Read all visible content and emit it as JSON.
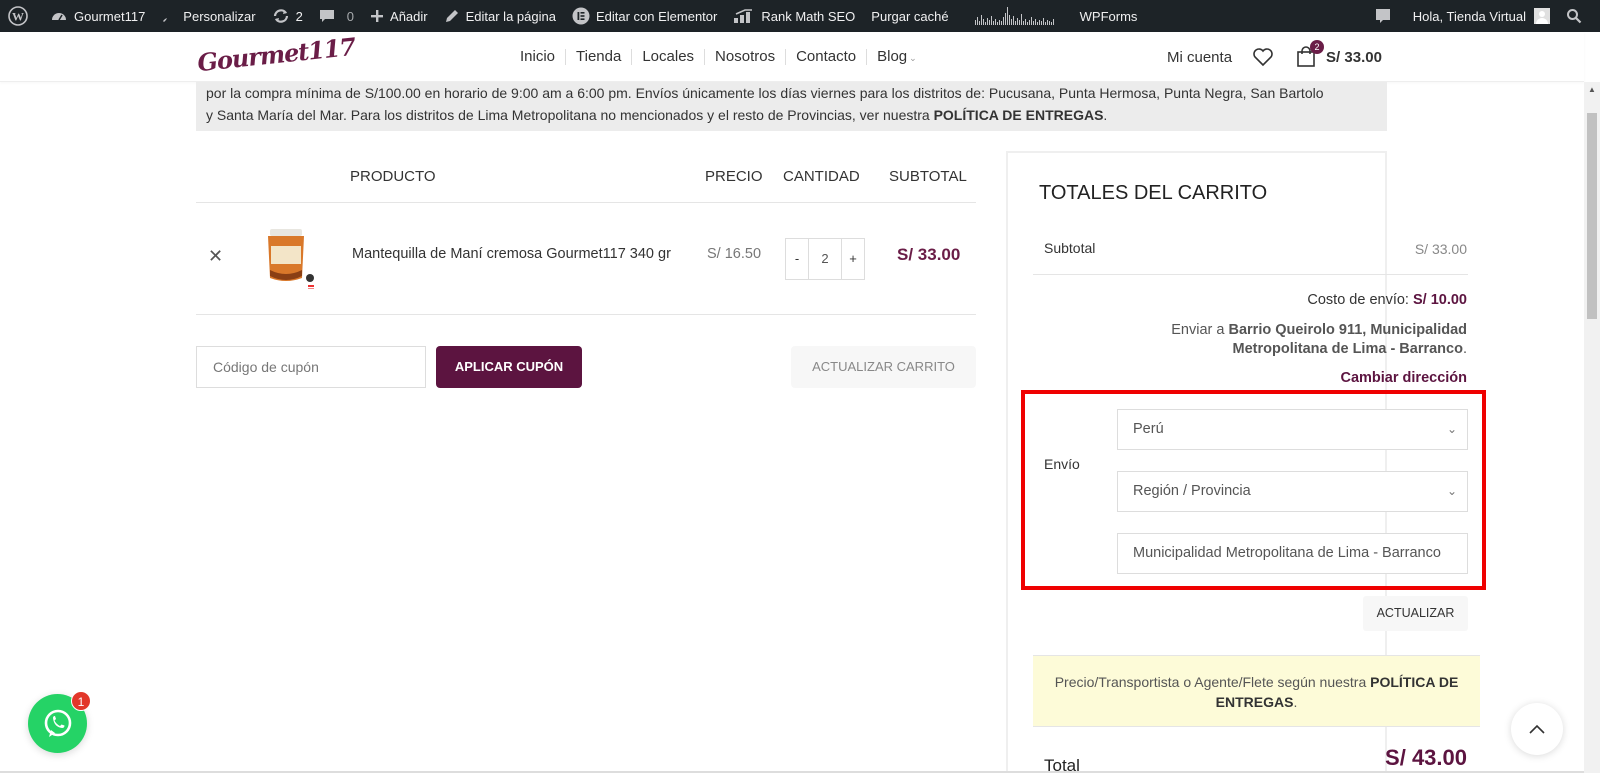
{
  "adminbar": {
    "site_name": "Gourmet117",
    "customize": "Personalizar",
    "updates_count": "2",
    "comments_count": "0",
    "add_new": "Añadir",
    "edit_page": "Editar la página",
    "edit_elementor": "Editar con Elementor",
    "rank_math": "Rank Math SEO",
    "purge_cache": "Purgar caché",
    "wpforms": "WPForms",
    "greeting": "Hola, Tienda Virtual"
  },
  "header": {
    "logo_text": "Gourmet117",
    "nav": [
      "Inicio",
      "Tienda",
      "Locales",
      "Nosotros",
      "Contacto",
      "Blog"
    ],
    "account": "Mi cuenta",
    "cart_count": "2",
    "cart_total": "S/ 33.00"
  },
  "notice": {
    "line1": "por la compra mínima de S/100.00 en horario de 9:00 am a 6:00 pm. Envíos únicamente los días viernes para los distritos de: Pucusana, Punta Hermosa, Punta Negra, San Bartolo",
    "line2_pre": "y Santa María del Mar. Para los distritos de Lima Metropolitana no mencionados y el resto de Provincias, ver nuestra ",
    "line2_bold": "POLÍTICA DE ENTREGAS",
    "line2_post": "."
  },
  "cart": {
    "headers": {
      "product": "PRODUCTO",
      "price": "PRECIO",
      "quantity": "CANTIDAD",
      "subtotal": "SUBTOTAL"
    },
    "items": [
      {
        "name": "Mantequilla de Maní cremosa Gourmet117 340 gr",
        "price": "S/ 16.50",
        "qty": "2",
        "subtotal": "S/ 33.00"
      }
    ],
    "coupon_placeholder": "Código de cupón",
    "apply_coupon": "APLICAR CUPÓN",
    "update_cart": "ACTUALIZAR CARRITO"
  },
  "totals": {
    "title": "TOTALES DEL CARRITO",
    "subtotal_label": "Subtotal",
    "subtotal_value": "S/ 33.00",
    "shipping_cost_label": "Costo de envío: ",
    "shipping_cost_value": "S/ 10.00",
    "ship_to_label": "Enviar a ",
    "ship_to_address": "Barrio Queirolo 911, Municipalidad Metropolitana de Lima - Barranco",
    "change_address": "Cambiar dirección",
    "envio_label": "Envío",
    "country": "Perú",
    "region_placeholder": "Región / Provincia",
    "district": "Municipalidad Metropolitana de Lima - Barranco",
    "update_button": "ACTUALIZAR",
    "policy_pre": "Precio/Transportista o Agente/Flete según nuestra ",
    "policy_bold": "POLÍTICA DE ENTREGAS",
    "policy_post": ".",
    "total_label": "Total",
    "total_value": "S/ 43.00"
  },
  "whatsapp": {
    "badge": "1"
  },
  "colors": {
    "brand": "#5c1440",
    "highlight": "#ef0000",
    "adminbar": "#1d2327"
  }
}
